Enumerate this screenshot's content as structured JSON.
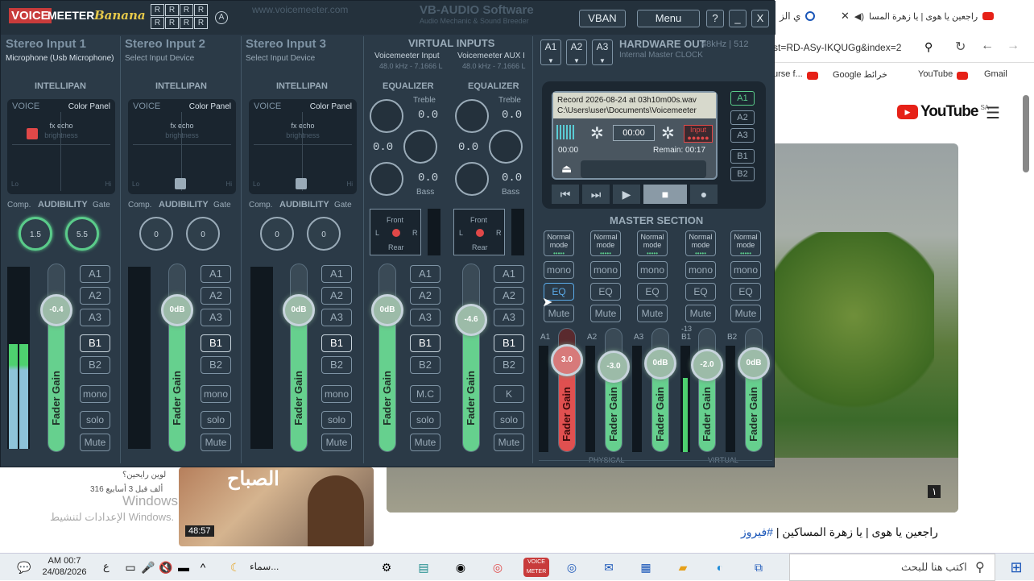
{
  "browser": {
    "tabs": [
      {
        "label": "راجعين يا هوى | يا زهرة المسا"
      },
      {
        "label": "ي الز"
      }
    ],
    "url": "st=RD-ASy-IKQUGg&index=2",
    "bookmarks": [
      "urse f...",
      "Google خرائط",
      "YouTube",
      "Gmail"
    ],
    "youtube_brand": "YouTube",
    "youtube_region": "SA",
    "video_title": "راجعين يا هوى | يا زهرة المساكين |",
    "video_tag": "#فيروز",
    "video_badge": "١",
    "left_snippet_1": "لوين رايحين؟",
    "left_snippet_2": "316 ألف  قبل 3 أسابيع",
    "windows_watermark_1": "Windows",
    "windows_watermark_2": "الإعدادات لتنشيط Windows.",
    "thumb_title": "الصباح",
    "thumb_duration": "48:57"
  },
  "vm": {
    "logo_voice": "VOICE",
    "logo_meeter": "MEETER",
    "logo_banana": "Banana",
    "r_grid": [
      "R",
      "R",
      "R",
      "R",
      "R",
      "R",
      "R",
      "R",
      "R",
      "R",
      "R",
      "R"
    ],
    "r_a": "A",
    "faint_url": "www.voicemeeter.com",
    "faint_vb": "VB-AUDIO Software",
    "faint_vb_sub": "Audio Mechanic & Sound Breeder",
    "vban": "VBAN",
    "menu": "Menu",
    "help": "?",
    "minimize": "_",
    "close": "X",
    "strips": [
      {
        "title": "Stereo Input 1",
        "sub": "Microphone (Usb Microphone)",
        "intelli": "INTELLIPAN",
        "voice": "VOICE",
        "color_panel": "Color Panel",
        "fx": "fx echo",
        "bright": "brightness",
        "lo": "Lo",
        "hi": "Hi",
        "comp": "Comp.",
        "aud": "AUDIBILITY",
        "gate": "Gate",
        "comp_val": "1.5",
        "gate_val": "5.5",
        "fader": "-0.4",
        "fader_label": "Fader Gain",
        "mono": "mono",
        "solo": "solo",
        "mute": "Mute"
      },
      {
        "title": "Stereo Input 2",
        "sub": "Select Input Device",
        "intelli": "INTELLIPAN",
        "voice": "VOICE",
        "color_panel": "Color Panel",
        "fx": "fx echo",
        "bright": "brightness",
        "lo": "Lo",
        "hi": "Hi",
        "comp": "Comp.",
        "aud": "AUDIBILITY",
        "gate": "Gate",
        "comp_val": "0",
        "gate_val": "0",
        "fader": "0dB",
        "fader_label": "Fader Gain",
        "mono": "mono",
        "solo": "solo",
        "mute": "Mute"
      },
      {
        "title": "Stereo Input 3",
        "sub": "Select Input Device",
        "intelli": "INTELLIPAN",
        "voice": "VOICE",
        "color_panel": "Color Panel",
        "fx": "fx echo",
        "bright": "brightness",
        "lo": "Lo",
        "hi": "Hi",
        "comp": "Comp.",
        "aud": "AUDIBILITY",
        "gate": "Gate",
        "comp_val": "0",
        "gate_val": "0",
        "fader": "0dB",
        "fader_label": "Fader Gain",
        "mono": "mono",
        "solo": "solo",
        "mute": "Mute"
      }
    ],
    "bus_buttons": [
      "A1",
      "A2",
      "A3",
      "B1",
      "B2"
    ],
    "virtual_title": "VIRTUAL INPUTS",
    "virtual": [
      {
        "name": "Voicemeeter Input",
        "rate": "48.0 kHz - 7.1666 L",
        "eq": "EQUALIZER",
        "treble": "Treble",
        "treble_val": "0.0",
        "mid_val": "0.0",
        "bass_val": "0.0",
        "bass": "Bass",
        "front": "Front",
        "rear": "Rear",
        "l": "L",
        "r": "R",
        "fader": "0dB",
        "fader_label": "Fader Gain",
        "mc": "M.C",
        "solo": "solo",
        "mute": "Mute"
      },
      {
        "name": "Voicemeeter AUX I",
        "rate": "48.0 kHz - 7.1666 L",
        "eq": "EQUALIZER",
        "treble": "Treble",
        "treble_val": "0.0",
        "mid_val": "0.0",
        "bass_val": "0.0",
        "bass": "Bass",
        "front": "Front",
        "rear": "Rear",
        "l": "L",
        "r": "R",
        "fader": "-4.6",
        "fader_label": "Fader Gain",
        "mc": "K",
        "solo": "solo",
        "mute": "Mute"
      }
    ],
    "hw_out": {
      "title": "HARDWARE OUT",
      "rate": "48kHz | 512",
      "clock": "Internal Master CLOCK",
      "a_buttons": [
        "A1",
        "A2",
        "A3"
      ]
    },
    "recorder": {
      "line1": "Record 2026-08-24 at 03h10m00s.wav",
      "line2": "C:\\Users\\user\\Documents\\Voicemeeter",
      "time": "00:00",
      "input_label": "Input",
      "elapsed": "00:00",
      "remain": "Remain: 00:17",
      "side": [
        "A1",
        "A2",
        "A3",
        "B1",
        "B2"
      ]
    },
    "master": {
      "title": "MASTER SECTION",
      "normal_mode": "Normal mode",
      "mono": "mono",
      "eq": "EQ",
      "mute": "Mute",
      "fader_label": "Fader Gain",
      "channels": [
        {
          "id": "A1",
          "val": "3.0"
        },
        {
          "id": "A2",
          "val": "-3.0"
        },
        {
          "id": "A3",
          "val": "0dB"
        },
        {
          "id": "B1",
          "val": "-2.0"
        },
        {
          "id": "B2",
          "val": "0dB"
        }
      ],
      "b1_level": "-13",
      "physical": "PHYSICAL",
      "virtual": "VIRTUAL"
    }
  },
  "taskbar": {
    "time": "AM 00:7",
    "date": "24/08/2026",
    "lang": "ع",
    "weather_label": "سماء...",
    "search_placeholder": "اكتب هنا للبحث"
  }
}
